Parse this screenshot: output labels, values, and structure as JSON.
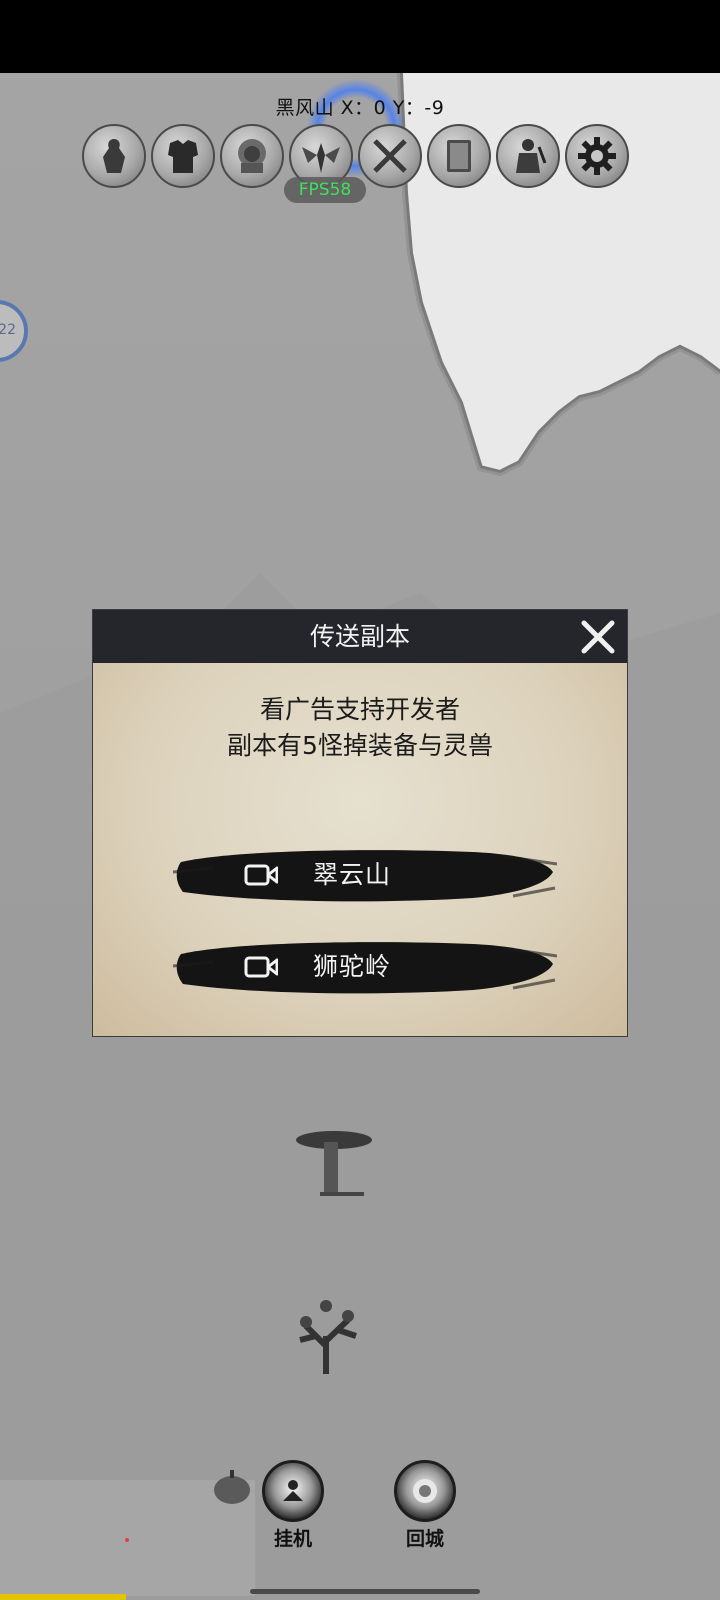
{
  "hud": {
    "location": "黑风山 X：0 Y：-9",
    "fps": "FPS58",
    "side_badge": "22"
  },
  "toolbar": [
    {
      "icon": "hero-portrait-icon"
    },
    {
      "icon": "armor-icon"
    },
    {
      "icon": "lion-beast-icon"
    },
    {
      "icon": "winged-warrior-icon"
    },
    {
      "icon": "crossed-swords-icon"
    },
    {
      "icon": "book-icon"
    },
    {
      "icon": "general-icon"
    },
    {
      "icon": "gear-icon"
    }
  ],
  "dialog": {
    "title": "传送副本",
    "line1": "看广告支持开发者",
    "line2": "副本有5怪掉装备与灵兽",
    "buttons": [
      {
        "label": "翠云山",
        "icon": "video-camera-icon"
      },
      {
        "label": "狮驼岭",
        "icon": "video-camera-icon"
      }
    ]
  },
  "bottom": {
    "idle_label": "挂机",
    "return_label": "回城"
  },
  "colors": {
    "fps_green": "#3fe05a",
    "portal_blue": "#3c78ff",
    "dialog_header": "#24262b",
    "progress_yellow": "#e4c400"
  }
}
